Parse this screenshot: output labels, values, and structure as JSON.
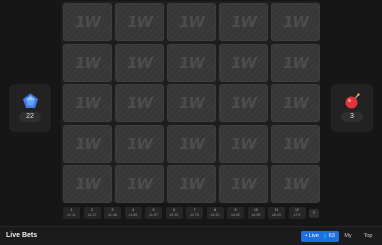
{
  "board": {
    "rows": 5,
    "cols": 5,
    "tile_label": "1W"
  },
  "gems": {
    "icon": "blue-gem-icon",
    "count": "22"
  },
  "bombs": {
    "icon": "red-bomb-icon",
    "count": "3"
  },
  "multipliers": [
    {
      "n": "1",
      "v": "x1.11"
    },
    {
      "n": "2",
      "v": "x1.27"
    },
    {
      "n": "3",
      "v": "x1.46"
    },
    {
      "n": "4",
      "v": "x1.69"
    },
    {
      "n": "5",
      "v": "x1.97"
    },
    {
      "n": "6",
      "v": "x2.32"
    },
    {
      "n": "7",
      "v": "x2.75"
    },
    {
      "n": "8",
      "v": "x3.31"
    },
    {
      "n": "9",
      "v": "x4.02"
    },
    {
      "n": "10",
      "v": "x4.95"
    },
    {
      "n": "11",
      "v": "x6.19"
    },
    {
      "n": "12",
      "v": "x7.9"
    }
  ],
  "next_label": "›",
  "live_bets": {
    "title": "Live Bets",
    "tabs": {
      "live": "• Live  👥 63",
      "my": "My",
      "top": "Top"
    }
  },
  "colors": {
    "accent": "#1f6fe0",
    "tile": "#363636",
    "background": "#161616"
  }
}
